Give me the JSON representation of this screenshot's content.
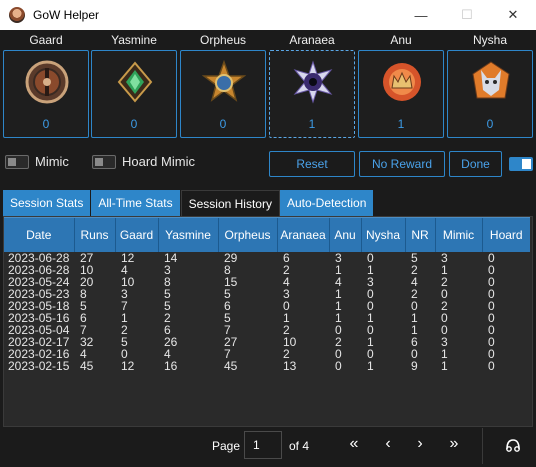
{
  "window": {
    "title": "GoW Helper",
    "minimize_glyph": "—",
    "maximize_glyph": "☐",
    "close_glyph": "✕"
  },
  "troops": [
    {
      "name": "Gaard",
      "count": "0",
      "icon": "shield-icon",
      "color": "#8a4a2c"
    },
    {
      "name": "Yasmine",
      "count": "0",
      "icon": "gem-icon",
      "color": "#2fa35a"
    },
    {
      "name": "Orpheus",
      "count": "0",
      "icon": "star-icon",
      "color": "#c8862e"
    },
    {
      "name": "Aranaea",
      "count": "1",
      "icon": "spider-eye-icon",
      "color": "#3a2b6e"
    },
    {
      "name": "Anu",
      "count": "1",
      "icon": "crown-icon",
      "color": "#d6542a"
    },
    {
      "name": "Nysha",
      "count": "0",
      "icon": "wolf-icon",
      "color": "#e07b2a"
    }
  ],
  "controls": {
    "mimic_label": "Mimic",
    "hoard_mimic_label": "Hoard Mimic",
    "reset_label": "Reset",
    "no_reward_label": "No Reward",
    "done_label": "Done"
  },
  "tabs": [
    {
      "label": "Session Stats",
      "active": false
    },
    {
      "label": "All-Time Stats",
      "active": false
    },
    {
      "label": "Session History",
      "active": true
    },
    {
      "label": "Auto-Detection",
      "active": false
    }
  ],
  "table": {
    "columns": [
      "Date",
      "Runs",
      "Gaard",
      "Yasmine",
      "Orpheus",
      "Aranaea",
      "Anu",
      "Nysha",
      "NR",
      "Mimic",
      "Hoard"
    ],
    "rows": [
      [
        "2023-06-28",
        "27",
        "12",
        "14",
        "29",
        "6",
        "3",
        "0",
        "5",
        "3",
        "0"
      ],
      [
        "2023-06-28",
        "10",
        "4",
        "3",
        "8",
        "2",
        "1",
        "1",
        "2",
        "1",
        "0"
      ],
      [
        "2023-05-24",
        "20",
        "10",
        "8",
        "15",
        "4",
        "4",
        "3",
        "4",
        "2",
        "0"
      ],
      [
        "2023-05-23",
        "8",
        "3",
        "5",
        "5",
        "3",
        "1",
        "0",
        "2",
        "0",
        "0"
      ],
      [
        "2023-05-18",
        "5",
        "7",
        "5",
        "6",
        "0",
        "1",
        "0",
        "0",
        "2",
        "0"
      ],
      [
        "2023-05-16",
        "6",
        "1",
        "2",
        "5",
        "1",
        "1",
        "1",
        "1",
        "0",
        "0"
      ],
      [
        "2023-05-04",
        "7",
        "2",
        "6",
        "7",
        "2",
        "0",
        "0",
        "1",
        "0",
        "0"
      ],
      [
        "2023-02-17",
        "32",
        "5",
        "26",
        "27",
        "10",
        "2",
        "1",
        "6",
        "3",
        "0"
      ],
      [
        "2023-02-16",
        "4",
        "0",
        "4",
        "7",
        "2",
        "0",
        "0",
        "0",
        "1",
        "0"
      ],
      [
        "2023-02-15",
        "45",
        "12",
        "16",
        "45",
        "13",
        "0",
        "1",
        "9",
        "1",
        "0"
      ]
    ]
  },
  "pager": {
    "page_label": "Page",
    "current_page": "1",
    "of_label": "of 4",
    "first_glyph": "«",
    "prev_glyph": "‹",
    "next_glyph": "›",
    "last_glyph": "»"
  },
  "colors": {
    "accent": "#2e86c9",
    "background": "#1b1b1b",
    "header": "#2d76b4"
  }
}
